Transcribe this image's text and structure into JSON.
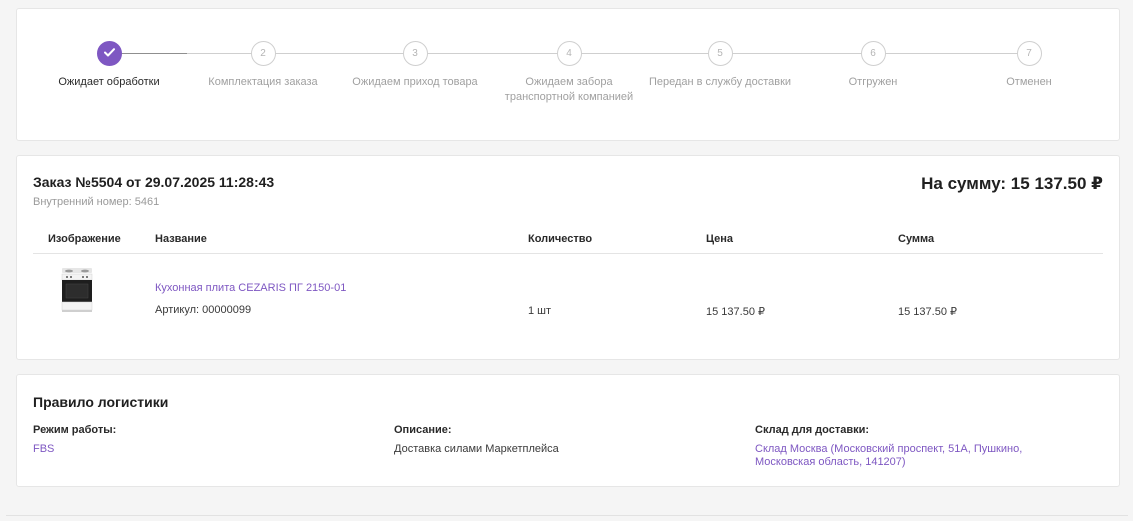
{
  "stepper": {
    "steps": [
      {
        "number": "",
        "label": "Ожидает обработки",
        "status": "completed"
      },
      {
        "number": "2",
        "label": "Комплектация заказа",
        "status": "pending"
      },
      {
        "number": "3",
        "label": "Ожидаем приход товара",
        "status": "pending"
      },
      {
        "number": "4",
        "label": "Ожидаем забора транспортной компанией",
        "status": "pending"
      },
      {
        "number": "5",
        "label": "Передан в службу доставки",
        "status": "pending"
      },
      {
        "number": "6",
        "label": "Отгружен",
        "status": "pending"
      },
      {
        "number": "7",
        "label": "Отменен",
        "status": "pending"
      }
    ],
    "accent_color": "#7e57c2"
  },
  "order": {
    "title": "Заказ №5504 от 29.07.2025 11:28:43",
    "internal_number": "Внутренний номер: 5461",
    "total": "На сумму: 15 137.50 ₽",
    "columns": [
      "Изображение",
      "Название",
      "Количество",
      "Цена",
      "Сумма"
    ],
    "items": [
      {
        "image_icon": "gas-stove-image",
        "name": "Кухонная плита CEZARIS ПГ 2150-01",
        "sku": "Артикул: 00000099",
        "quantity": "1 шт",
        "price": "15 137.50 ₽",
        "sum": "15 137.50 ₽"
      }
    ]
  },
  "logistics": {
    "title": "Правило логистики",
    "mode_label": "Режим работы:",
    "mode_value": "FBS",
    "description_label": "Описание:",
    "description_value": "Доставка силами Маркетплейса",
    "warehouse_label": "Склад для доставки:",
    "warehouse_value_line1": "Склад Москва (Московский проспект, 51А, Пушкино,",
    "warehouse_value_line2": "Московская область, 141207)"
  }
}
